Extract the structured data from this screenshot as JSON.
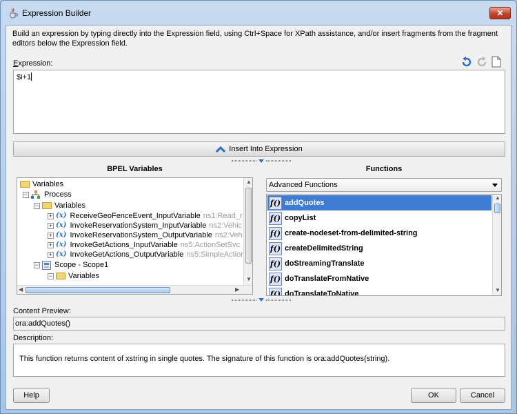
{
  "window": {
    "title": "Expression Builder",
    "close_label": "✕"
  },
  "intro_text": "Build an expression by typing directly into the Expression field, using Ctrl+Space for XPath assistance, and/or insert fragments from the fragment editors below the Expression field.",
  "expression": {
    "label": "Expression:",
    "value": "$i+1"
  },
  "insert_button": {
    "label": "Insert Into Expression"
  },
  "variables_panel": {
    "heading": "BPEL Variables",
    "tree": [
      {
        "label": "Variables",
        "gray": ""
      },
      {
        "label": "Process",
        "gray": ""
      },
      {
        "label": "Variables",
        "gray": ""
      },
      {
        "label": "ReceiveGeoFenceEvent_InputVariable",
        "gray": "ns1:Read_r"
      },
      {
        "label": "InvokeReservationSystem_InputVariable",
        "gray": "ns2:Vehic"
      },
      {
        "label": "InvokeReservationSystem_OutputVariable",
        "gray": "ns2:Veh"
      },
      {
        "label": "InvokeGetActions_InputVariable",
        "gray": "ns5:ActionSetSvc"
      },
      {
        "label": "InvokeGetActions_OutputVariable",
        "gray": "ns5:SimpleAction"
      },
      {
        "label": "Scope - Scope1",
        "gray": ""
      },
      {
        "label": "Variables",
        "gray": ""
      }
    ]
  },
  "functions_panel": {
    "heading": "Functions",
    "category": "Advanced Functions",
    "items": [
      "addQuotes",
      "copyList",
      "create-nodeset-from-delimited-string",
      "createDelimitedString",
      "doStreamingTranslate",
      "doTranslateFromNative",
      "doTranslateToNative"
    ],
    "icon_text": "f()"
  },
  "content_preview": {
    "label": "Content Preview:",
    "value": "ora:addQuotes()"
  },
  "description": {
    "label": "Description:",
    "value": "This function returns content of xstring in single quotes. The signature of this function is ora:addQuotes(string)."
  },
  "buttons": {
    "help": "Help",
    "ok": "OK",
    "cancel": "Cancel"
  },
  "colors": {
    "selection": "#3d7bd4",
    "titlebar": "#b9d1ea",
    "close": "#c4442d"
  }
}
